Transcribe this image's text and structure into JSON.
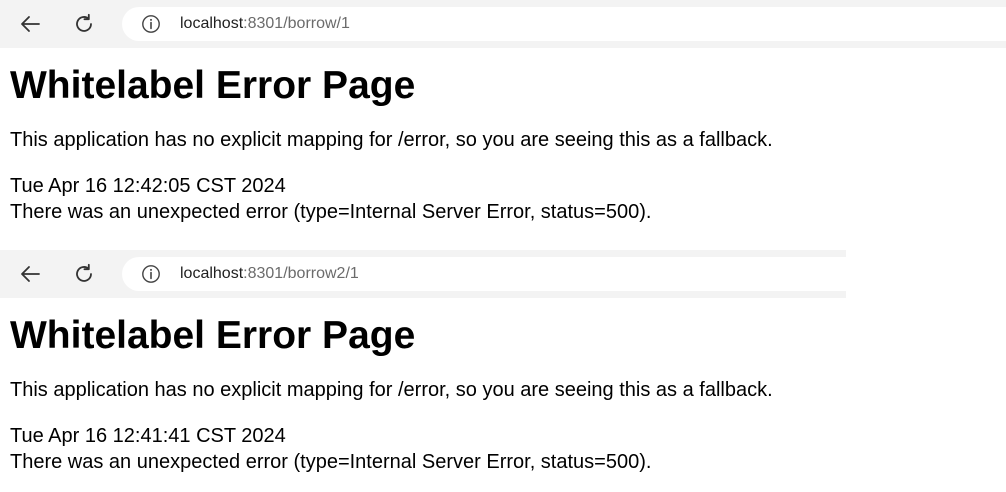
{
  "windows": [
    {
      "url_host": "localhost",
      "url_rest": ":8301/borrow/1",
      "heading": "Whitelabel Error Page",
      "description": "This application has no explicit mapping for /error, so you are seeing this as a fallback.",
      "timestamp": "Tue Apr 16 12:42:05 CST 2024",
      "error_message": "There was an unexpected error (type=Internal Server Error, status=500)."
    },
    {
      "url_host": "localhost",
      "url_rest": ":8301/borrow2/1",
      "heading": "Whitelabel Error Page",
      "description": "This application has no explicit mapping for /error, so you are seeing this as a fallback.",
      "timestamp": "Tue Apr 16 12:41:41 CST 2024",
      "error_message": "There was an unexpected error (type=Internal Server Error, status=500)."
    }
  ],
  "icons": {
    "back": "back-arrow-icon",
    "reload": "reload-icon",
    "info": "info-icon"
  },
  "colors": {
    "toolbar_bg": "#f3f3f3",
    "address_bg": "#ffffff",
    "url_host": "#1f1f1f",
    "url_rest": "#6b6b6b"
  }
}
